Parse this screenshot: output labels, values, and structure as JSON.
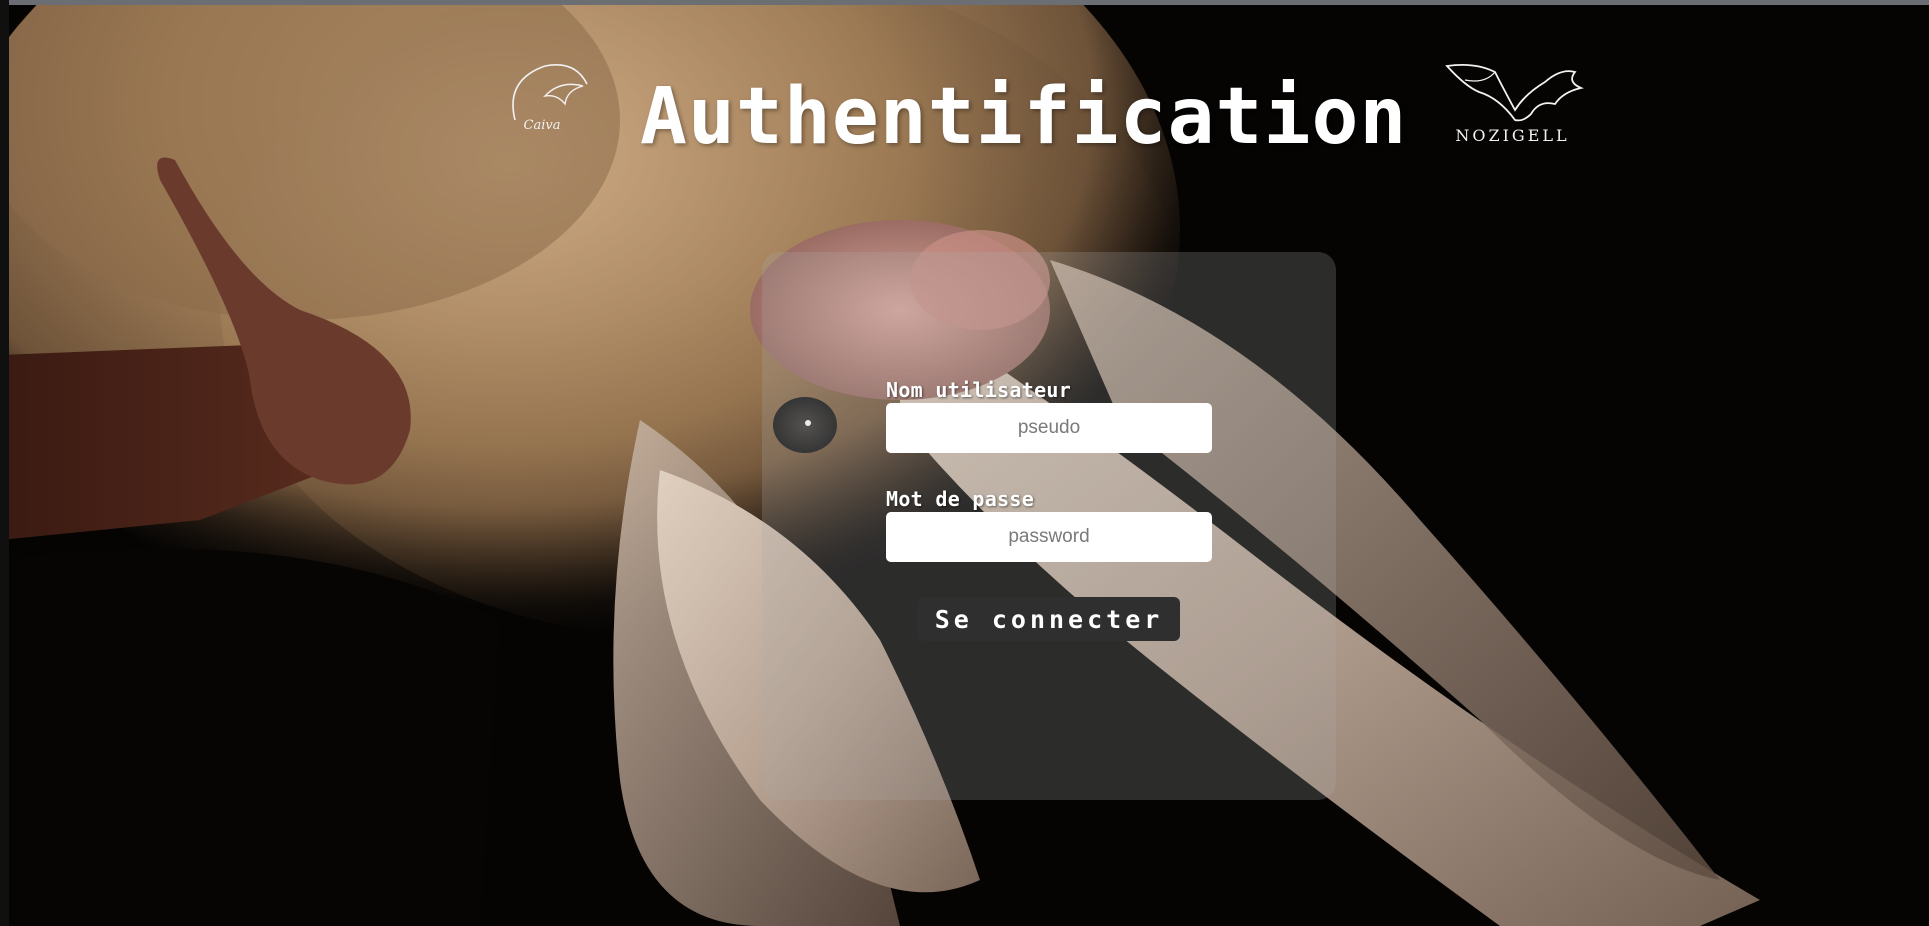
{
  "header": {
    "title": "Authentification",
    "logo_left_text": "Caiva",
    "logo_right_text": "NOZIGELL"
  },
  "form": {
    "username_label": "Nom utilisateur",
    "username_placeholder": "pseudo",
    "password_label": "Mot de passe",
    "password_placeholder": "password",
    "submit_label": "Se connecter"
  },
  "colors": {
    "background": "#050403",
    "title_text": "#ffffff",
    "panel_overlay": "rgba(170,170,170,0.24)",
    "button_background": "#2f2f2f",
    "input_background": "#ffffff"
  },
  "icons": {
    "left_logo": "caiva-logo",
    "right_logo": "nozigell-bat-logo"
  }
}
